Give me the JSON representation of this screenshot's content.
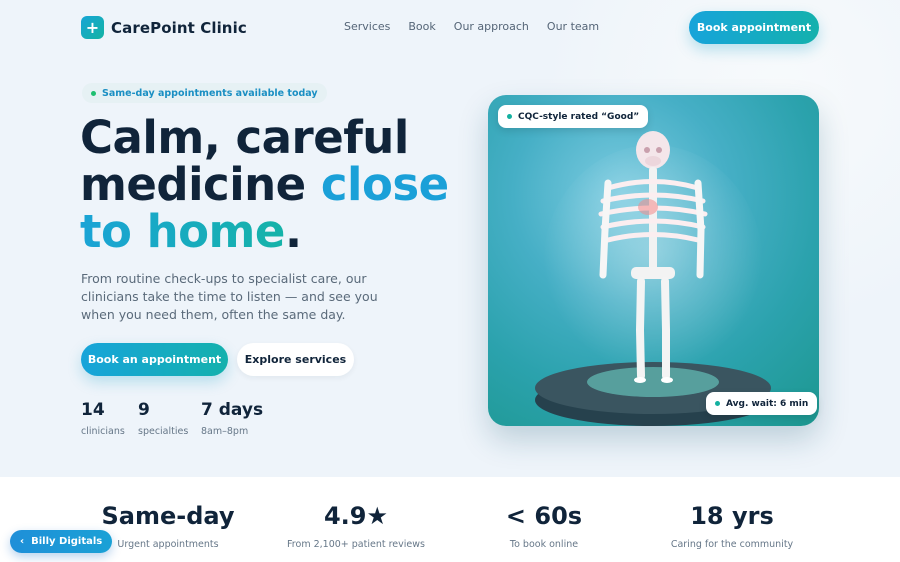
{
  "brand": {
    "name": "CarePoint Clinic",
    "logo_glyph": "+"
  },
  "nav": {
    "links": [
      "Services",
      "Book",
      "Our approach",
      "Our team"
    ],
    "cta": "Book appointment"
  },
  "hero": {
    "pill": "Same-day appointments available today",
    "headline": {
      "line1": "Calm, careful",
      "line2a": "medicine ",
      "line2b": "close",
      "line3a": "to home",
      "line3b": "."
    },
    "lede": "From routine check-ups to specialist care, our clinicians take the time to listen — and see you when you need them, often the same day.",
    "primary_button": "Book an appointment",
    "secondary_button": "Explore services",
    "stats": [
      {
        "value": "14",
        "label": "clinicians"
      },
      {
        "value": "9",
        "label": "specialties"
      },
      {
        "value": "7 days",
        "label": "8am–8pm"
      }
    ],
    "image_badges": {
      "rating": "CQC-style rated “Good”",
      "wait": "Avg. wait: 6 min"
    }
  },
  "metrics": [
    {
      "value": "Same-day",
      "label": "Urgent appointments"
    },
    {
      "value": "4.9★",
      "label": "From 2,100+ patient reviews"
    },
    {
      "value": "< 60s",
      "label": "To book online"
    },
    {
      "value": "18 yrs",
      "label": "Caring for the community"
    }
  ],
  "floating_badge": {
    "icon": "‹",
    "label": "Billy Digitals"
  },
  "colors": {
    "accent_blue": "#1aa3d6",
    "accent_teal": "#15b3a8",
    "dark": "#10243a",
    "status_green": "#1fbf71"
  }
}
